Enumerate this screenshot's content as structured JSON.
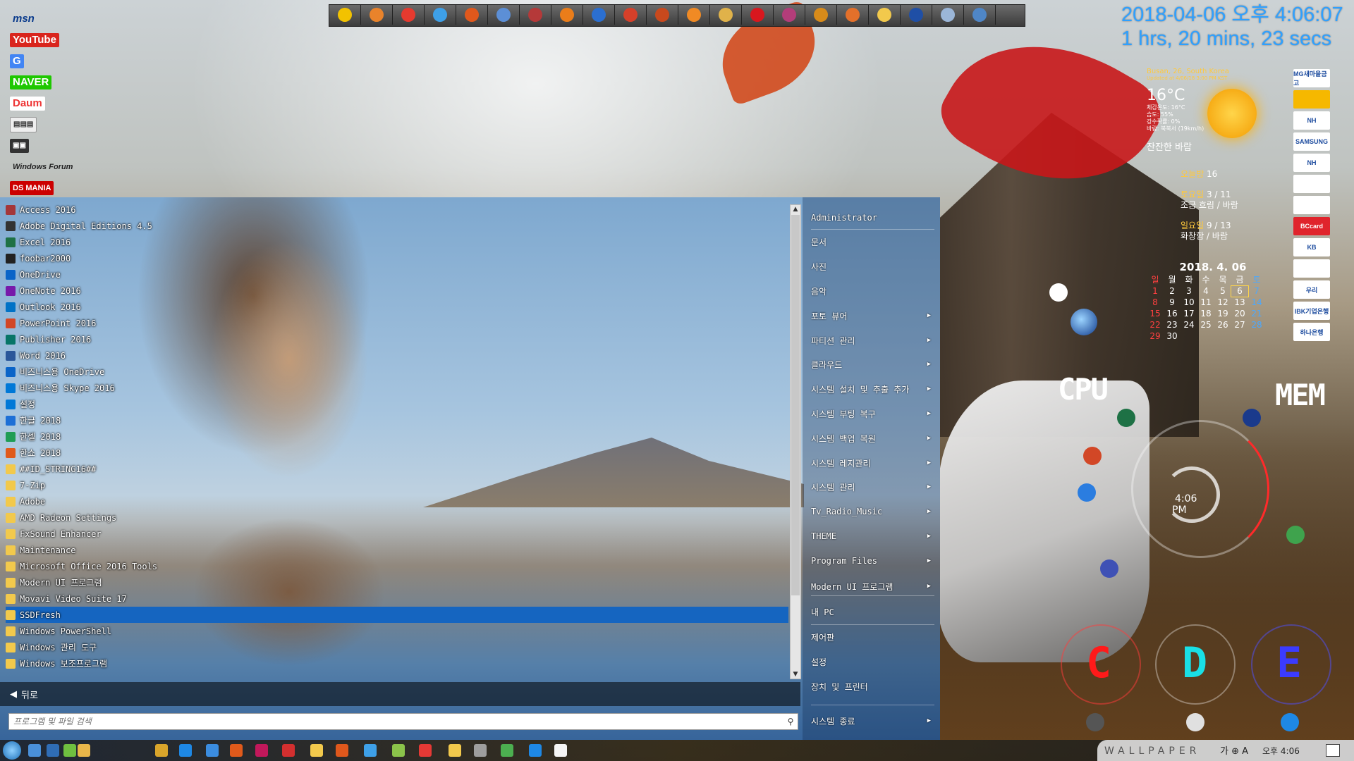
{
  "desktop": {
    "shortcuts": [
      "msn",
      "YouTube",
      "G",
      "NAVER",
      "Daum",
      "",
      "",
      "Windows Forum",
      "DS MANIA"
    ]
  },
  "quick_launch": {
    "icon_colors": [
      "#f2c200",
      "#e9832b",
      "#e63a2f",
      "#3ea0e8",
      "#e0581c",
      "#5c8fd6",
      "#b53939",
      "#ea7d1a",
      "#2b6fd1",
      "#d6402a",
      "#c9491d",
      "#f08a24",
      "#e0b24a",
      "#d9171e",
      "#b33d7a",
      "#d88b1a",
      "#e4702a",
      "#f2c94c",
      "#1f4fa6",
      "#9bb6d8",
      "#4f86c6"
    ]
  },
  "clock": {
    "datetime": "2018-04-06 오후 4:06:07",
    "uptime": "1 hrs, 20 mins, 23 secs"
  },
  "weather": {
    "location": "Busan, 26, South Korea",
    "updated": "Updated at 4/06/18 3:00 PM KST",
    "temp": "16°C",
    "details": [
      "체감온도: 16°C",
      "습도: 55%",
      "강수확률: 0%",
      "바람: 북북서 (19km/h)"
    ],
    "description": "잔잔한 바람",
    "today_label": "오늘밤",
    "today_value": "16",
    "forecast": [
      {
        "day": "토요일",
        "temps": "3 / 11",
        "desc": "조금 흐림 / 바람"
      },
      {
        "day": "일요일",
        "temps": "9 / 13",
        "desc": "화창함 / 바람"
      }
    ]
  },
  "calendar": {
    "title": "2018. 4. 06",
    "weekdays": [
      "일",
      "월",
      "화",
      "수",
      "목",
      "금",
      "토"
    ],
    "weeks": [
      [
        "1",
        "2",
        "3",
        "4",
        "5",
        "6",
        "7"
      ],
      [
        "8",
        "9",
        "10",
        "11",
        "12",
        "13",
        "14"
      ],
      [
        "15",
        "16",
        "17",
        "18",
        "19",
        "20",
        "21"
      ],
      [
        "22",
        "23",
        "24",
        "25",
        "26",
        "27",
        "28"
      ],
      [
        "29",
        "30",
        "",
        "",
        "",
        "",
        ""
      ]
    ],
    "today": "6"
  },
  "banks": [
    "MG새마을금고",
    "",
    "NH",
    "SAMSUNG",
    "NH",
    "",
    "",
    "BCcard",
    "KB",
    "",
    "우리",
    "IBK기업은행",
    "하나은행"
  ],
  "gauges": {
    "cpu_label": "CPU",
    "mem_label": "MEM",
    "clock_time": "4:06",
    "clock_ampm": "PM",
    "drives": [
      "C",
      "D",
      "E"
    ],
    "drive_colors": [
      "#ff1a1a",
      "#19e0e6",
      "#3b3bff"
    ]
  },
  "start_menu": {
    "programs": [
      {
        "label": "Access 2016",
        "color": "#a4373a"
      },
      {
        "label": "Adobe Digital Editions 4.5",
        "color": "#333333"
      },
      {
        "label": "Excel 2016",
        "color": "#1e7145"
      },
      {
        "label": "foobar2000",
        "color": "#222222"
      },
      {
        "label": "OneDrive",
        "color": "#0a64c8"
      },
      {
        "label": "OneNote 2016",
        "color": "#7719aa"
      },
      {
        "label": "Outlook 2016",
        "color": "#0072c6"
      },
      {
        "label": "PowerPoint 2016",
        "color": "#d24726"
      },
      {
        "label": "Publisher 2016",
        "color": "#077568"
      },
      {
        "label": "Word 2016",
        "color": "#2b579a"
      },
      {
        "label": "비즈니스용 OneDrive",
        "color": "#0a64c8"
      },
      {
        "label": "비즈니스용 Skype 2016",
        "color": "#0078d7"
      },
      {
        "label": "설정",
        "color": "#0078d7"
      },
      {
        "label": "한글 2018",
        "color": "#1d6fd6"
      },
      {
        "label": "한셀 2018",
        "color": "#1f9d55"
      },
      {
        "label": "한쇼 2018",
        "color": "#e05a1b"
      },
      {
        "label": "##ID_STRING16##",
        "color": "#f2c94c"
      },
      {
        "label": "7-Zip",
        "color": "#f2c94c"
      },
      {
        "label": "Adobe",
        "color": "#f2c94c"
      },
      {
        "label": "AMD Radeon Settings",
        "color": "#f2c94c"
      },
      {
        "label": "FxSound Enhancer",
        "color": "#f2c94c"
      },
      {
        "label": "Maintenance",
        "color": "#f2c94c"
      },
      {
        "label": "Microsoft Office 2016 Tools",
        "color": "#f2c94c"
      },
      {
        "label": "Modern UI 프로그램",
        "color": "#f2c94c"
      },
      {
        "label": "Movavi Video Suite 17",
        "color": "#f2c94c"
      },
      {
        "label": "SSDFresh",
        "color": "#f2c94c"
      },
      {
        "label": "Windows PowerShell",
        "color": "#f2c94c"
      },
      {
        "label": "Windows 관리 도구",
        "color": "#f2c94c"
      },
      {
        "label": "Windows 보조프로그램",
        "color": "#f2c94c"
      }
    ],
    "selected": "SSDFresh",
    "back_label": "뒤로",
    "search_placeholder": "프로그램 및 파일 검색",
    "right_items": [
      {
        "label": "Administrator",
        "arrow": ""
      },
      {
        "label": "문서",
        "arrow": ""
      },
      {
        "label": "사진",
        "arrow": ""
      },
      {
        "label": "음악",
        "arrow": ""
      },
      {
        "label": "포토 뷰어",
        "arrow": "▶"
      },
      {
        "label": "파티션 관리",
        "arrow": "▶"
      },
      {
        "label": "클라우드",
        "arrow": "▶"
      },
      {
        "label": "시스템 설치 및 추출 추가",
        "arrow": "▶"
      },
      {
        "label": "시스템 부팅 복구",
        "arrow": "▶"
      },
      {
        "label": "시스템 백업 복원",
        "arrow": "▶"
      },
      {
        "label": "시스템 레지관리",
        "arrow": "▶"
      },
      {
        "label": "시스템 관리",
        "arrow": "▶"
      },
      {
        "label": "Tv_Radio_Music",
        "arrow": "▶"
      },
      {
        "label": "THEME",
        "arrow": "▶"
      },
      {
        "label": "Program Files",
        "arrow": "▶"
      },
      {
        "label": "Modern UI 프로그램",
        "arrow": "▶"
      },
      {
        "label": "내 PC",
        "arrow": ""
      },
      {
        "label": "제어판",
        "arrow": ""
      },
      {
        "label": "설정",
        "arrow": ""
      },
      {
        "label": "장치 및 프린터",
        "arrow": ""
      },
      {
        "label": "시스템 종료",
        "arrow": "▶"
      }
    ]
  },
  "taskbar": {
    "icon_colors": [
      "#4a90d9",
      "#2f6db5",
      "#6fbf40",
      "#e8b64a",
      "#d9a52b",
      "#1e88e5",
      "#3b8de0",
      "#e05a1b",
      "#c2185b",
      "#d32f2f",
      "#f2c94c",
      "#e0581c",
      "#3ea0e8",
      "#8bc34a",
      "#e53935",
      "#f2c94c",
      "#9e9e9e",
      "#4caf50",
      "#1e88e5",
      "#f5f5f5"
    ],
    "brand": "WALLPAPER",
    "ime": "가 ⊕ A",
    "time": "오후 4:06"
  }
}
